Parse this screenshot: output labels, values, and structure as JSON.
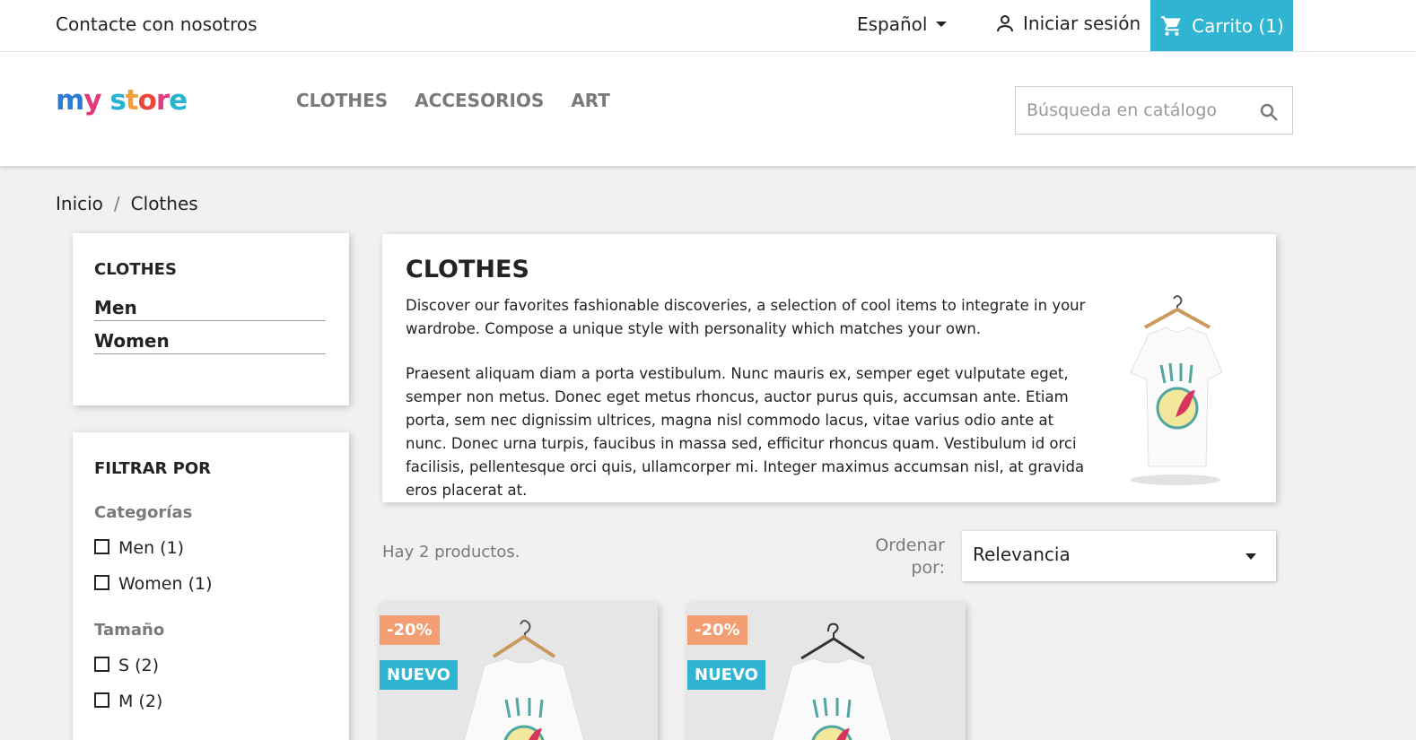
{
  "topnav": {
    "contact": "Contacte con nosotros",
    "language": "Español",
    "signin": "Iniciar sesión",
    "cart": "Carrito (1)"
  },
  "header": {
    "logo": "my store",
    "menu": [
      "Clothes",
      "Accesorios",
      "Art"
    ],
    "search_placeholder": "Búsqueda en catálogo"
  },
  "breadcrumb": {
    "home": "Inicio",
    "separator": "/",
    "current": "Clothes"
  },
  "sidebar": {
    "category_title": "Clothes",
    "subcategories": [
      "Men",
      "Women"
    ],
    "filter_title": "Filtrar por",
    "facets": [
      {
        "title": "Categorías",
        "items": [
          "Men (1)",
          "Women (1)"
        ]
      },
      {
        "title": "Tamaño",
        "items": [
          "S (2)",
          "M (2)"
        ]
      }
    ]
  },
  "category": {
    "title": "Clothes",
    "desc1": "Discover our favorites fashionable discoveries, a selection of cool items to integrate in your wardrobe. Compose a unique style with personality which matches your own.",
    "desc2": "Praesent aliquam diam a porta vestibulum. Nunc mauris ex, semper eget vulputate eget, semper non metus. Donec eget metus rhoncus, auctor purus quis, accumsan ante. Etiam porta, sem nec dignissim ultrices, magna nisl commodo lacus, vitae varius odio ante at nunc. Donec urna turpis, faucibus in massa sed, efficitur rhoncus quam. Vestibulum id orci facilisis, pellentesque orci quis, ullamcorper mi. Integer maximus accumsan nisl, at gravida eros placerat at."
  },
  "products": {
    "count": "Hay 2 productos.",
    "sort_label": "Ordenar por:",
    "sort_value": "Relevancia",
    "items": [
      {
        "discount": "-20%",
        "badge": "Nuevo"
      },
      {
        "discount": "-20%",
        "badge": "Nuevo"
      }
    ]
  },
  "colors": {
    "accent": "#2fb5d2",
    "discount": "#f39d72"
  }
}
